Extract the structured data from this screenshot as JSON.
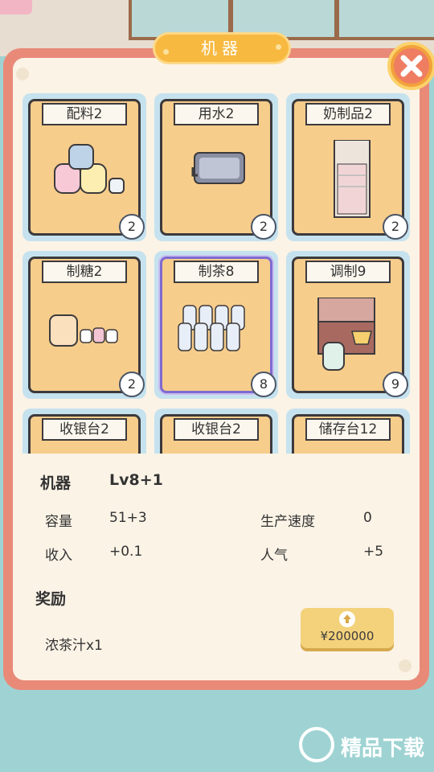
{
  "title": "机器",
  "close_icon": "close-icon",
  "machines": [
    {
      "name": "配料2",
      "count": "2",
      "icon": "ingredient-jars-icon",
      "selected": false
    },
    {
      "name": "用水2",
      "count": "2",
      "icon": "water-sink-icon",
      "selected": false
    },
    {
      "name": "奶制品2",
      "count": "2",
      "icon": "fridge-icon",
      "selected": false
    },
    {
      "name": "制糖2",
      "count": "2",
      "icon": "sugar-dispenser-icon",
      "selected": false
    },
    {
      "name": "制茶8",
      "count": "8",
      "icon": "tea-bottles-icon",
      "selected": true
    },
    {
      "name": "调制9",
      "count": "9",
      "icon": "mixing-station-icon",
      "selected": false
    },
    {
      "name": "收银台2",
      "count": "",
      "icon": "cashier-icon",
      "selected": false
    },
    {
      "name": "收银台2",
      "count": "",
      "icon": "cashier-icon",
      "selected": false
    },
    {
      "name": "储存台12",
      "count": "",
      "icon": "storage-icon",
      "selected": false
    }
  ],
  "details": {
    "machine_label": "机器",
    "level": "Lv8+1",
    "capacity_label": "容量",
    "capacity_value": "51+3",
    "speed_label": "生产速度",
    "speed_value": "0",
    "income_label": "收入",
    "income_value": "+0.1",
    "popularity_label": "人气",
    "popularity_value": "+5",
    "reward_label": "奖励",
    "reward_item": "浓茶汁x1",
    "upgrade_price": "¥200000"
  },
  "watermark": {
    "text": "精品下载"
  },
  "colors": {
    "panel_border": "#e98a78",
    "panel_bg": "#fbf3e6",
    "card_bg": "#f7cd8c",
    "title_tab": "#f7b940",
    "upgrade_button": "#f3d27b"
  }
}
